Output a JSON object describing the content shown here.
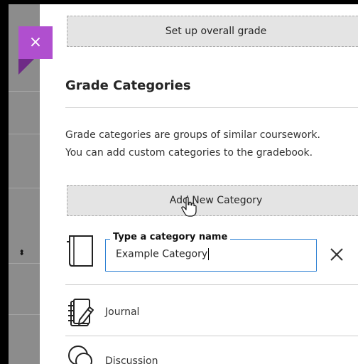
{
  "panel": {
    "close_label": "×",
    "overall_grade_button": "Set up overall grade",
    "heading": "Grade Categories",
    "description_line1": "Grade categories are groups of similar coursework.",
    "description_line2": "You can add custom categories to the gradebook.",
    "add_category_button": "Add New Category"
  },
  "new_category": {
    "field_label": "Type a category name",
    "field_value": "Example Category"
  },
  "categories": [
    {
      "label": "Journal",
      "icon": "journal-icon"
    },
    {
      "label": "Discussion",
      "icon": "discussion-icon"
    }
  ],
  "background": {
    "sort_icon": "⬍"
  },
  "colors": {
    "accent": "#b04fcf",
    "focus": "#2b7fd3"
  }
}
